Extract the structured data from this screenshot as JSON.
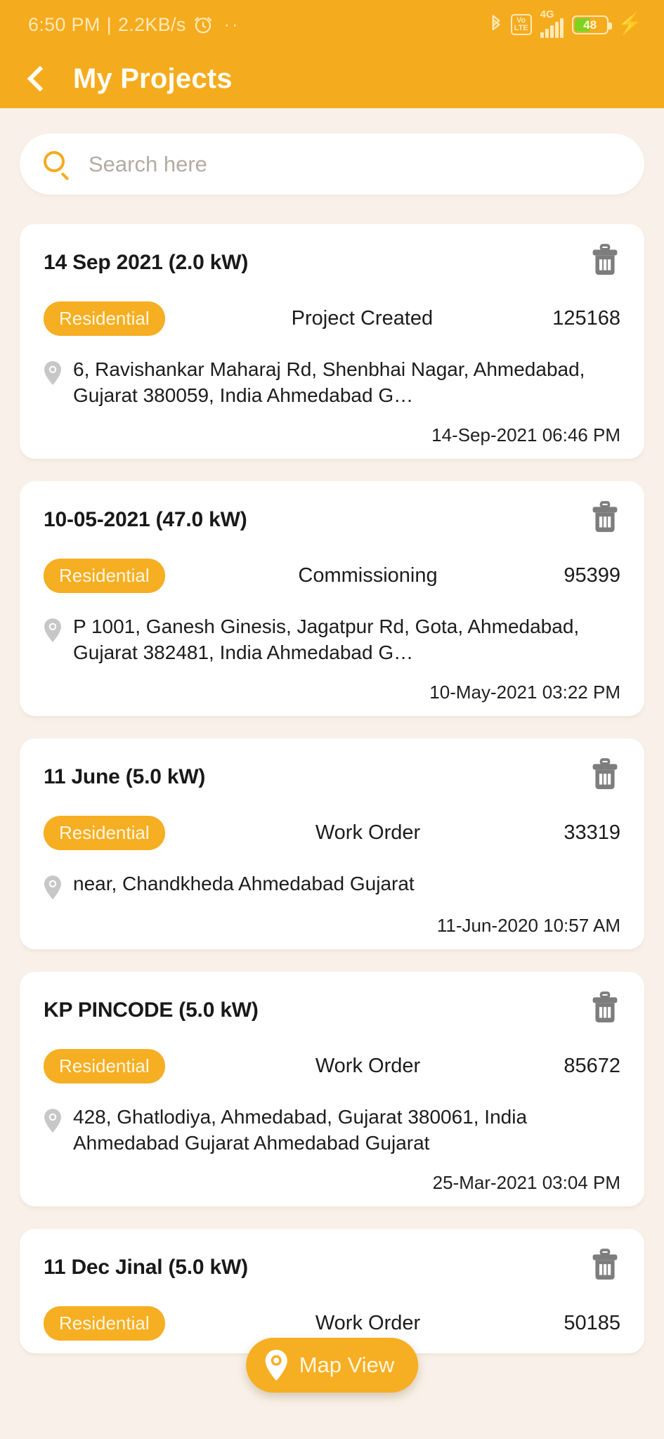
{
  "status_bar": {
    "time": "6:50 PM",
    "separator": "|",
    "network_speed": "2.2KB/s",
    "alarm_icon": "alarm-clock-icon",
    "more_dots": "··",
    "bluetooth_icon": "bluetooth-icon",
    "volte_line1": "Vo",
    "volte_line2": "LTE",
    "network_type": "4G",
    "battery_percent": "48",
    "charging_icon": "lightning-bolt-icon"
  },
  "app_bar": {
    "back_icon": "back-chevron-icon",
    "title": "My Projects"
  },
  "search": {
    "icon": "search-icon",
    "placeholder": "Search here",
    "value": ""
  },
  "colors": {
    "brand_orange": "#f5ab1e",
    "badge_orange": "#f6ae22",
    "page_background": "#f9f1e9",
    "card_background": "#ffffff",
    "title_text": "#fffdf5",
    "battery_green": "#7ed321"
  },
  "map_view_button": {
    "label": "Map View",
    "icon": "location-pin-icon"
  },
  "delete_icon_name": "trash-icon",
  "location_icon_name": "location-pin-icon",
  "projects": [
    {
      "title": "14 Sep 2021 (2.0 kW)",
      "category": "Residential",
      "stage": "Project Created",
      "project_id": "125168",
      "address": "6, Ravishankar Maharaj Rd, Shenbhai Nagar, Ahmedabad, Gujarat 380059, India Ahmedabad G…",
      "timestamp": "14-Sep-2021 06:46 PM"
    },
    {
      "title": "10-05-2021 (47.0 kW)",
      "category": "Residential",
      "stage": "Commissioning",
      "project_id": "95399",
      "address": "P 1001, Ganesh Ginesis, Jagatpur Rd, Gota, Ahmedabad, Gujarat 382481, India Ahmedabad G…",
      "timestamp": "10-May-2021 03:22 PM"
    },
    {
      "title": "11 June (5.0 kW)",
      "category": "Residential",
      "stage": "Work Order",
      "project_id": "33319",
      "address": "near, Chandkheda Ahmedabad Gujarat",
      "timestamp": "11-Jun-2020 10:57 AM"
    },
    {
      "title": "KP PINCODE (5.0 kW)",
      "category": "Residential",
      "stage": "Work Order",
      "project_id": "85672",
      "address": "428, Ghatlodiya, Ahmedabad, Gujarat 380061, India Ahmedabad Gujarat Ahmedabad Gujarat",
      "timestamp": "25-Mar-2021 03:04 PM"
    },
    {
      "title": "11 Dec Jinal (5.0 kW)",
      "category": "Residential",
      "stage": "Work Order",
      "project_id": "50185",
      "address": "",
      "timestamp": ""
    }
  ]
}
